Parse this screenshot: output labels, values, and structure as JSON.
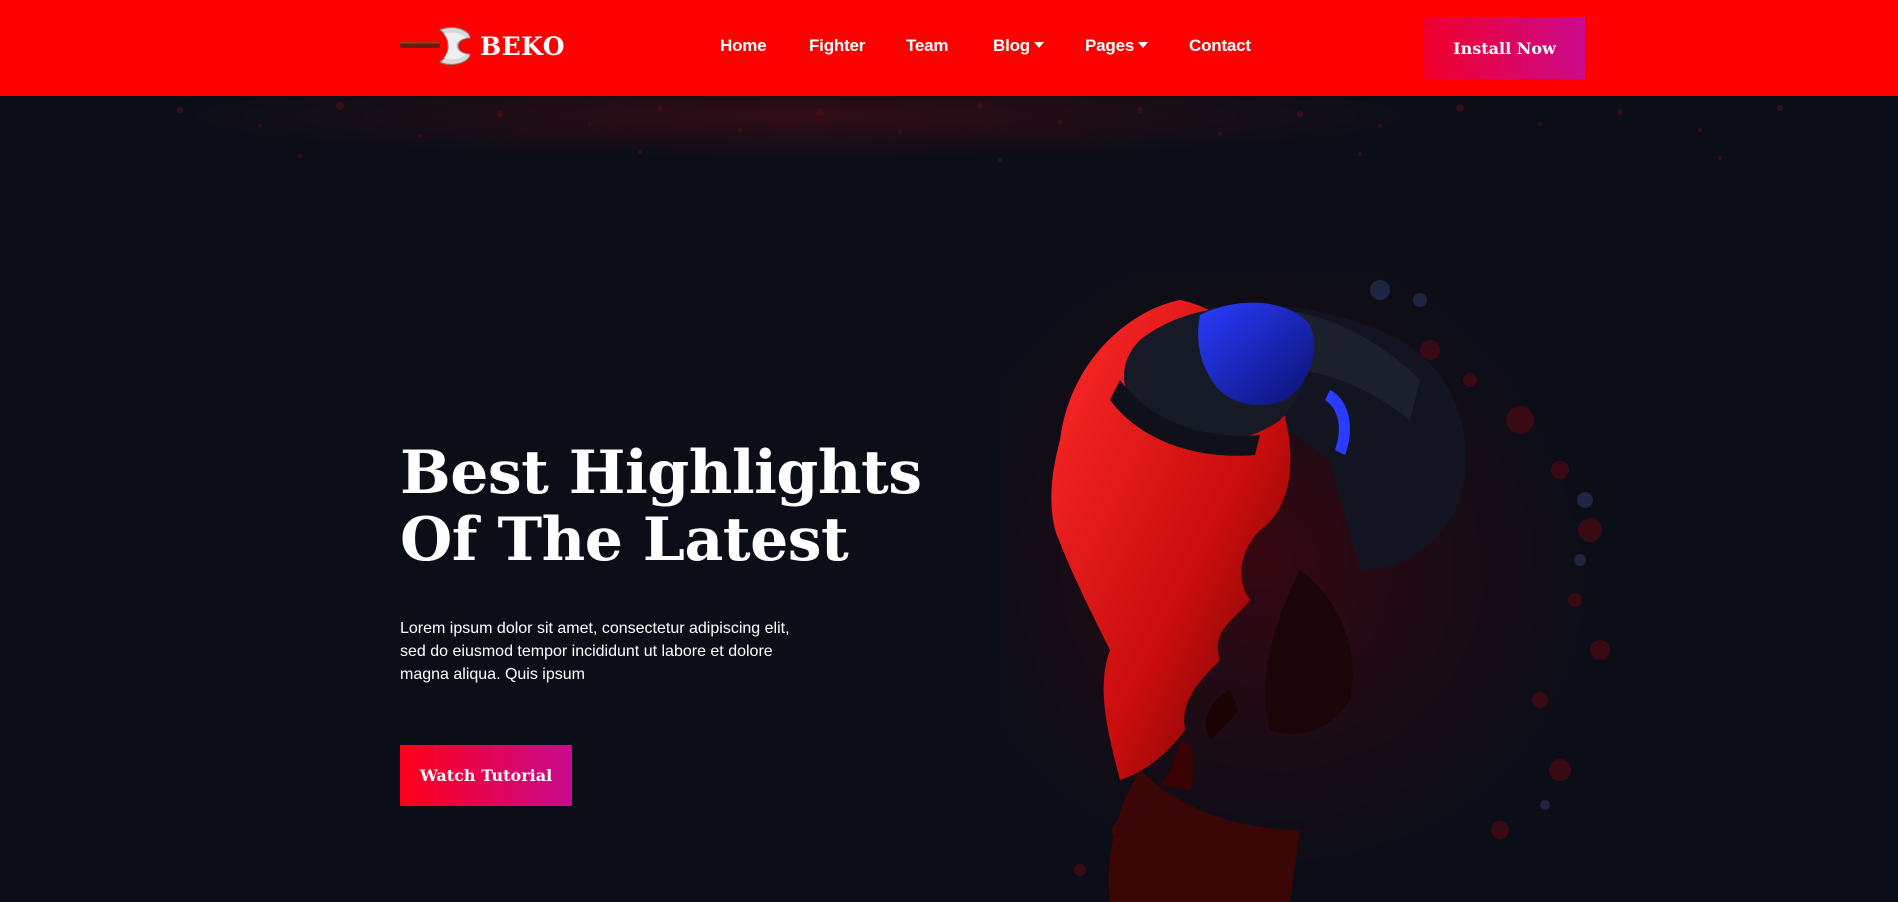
{
  "brand": {
    "name": "BEKO",
    "logo_icon": "axe-icon"
  },
  "nav": {
    "items": [
      {
        "label": "Home",
        "dropdown": false
      },
      {
        "label": "Fighter",
        "dropdown": false
      },
      {
        "label": "Team",
        "dropdown": false
      },
      {
        "label": "Blog",
        "dropdown": true
      },
      {
        "label": "Pages",
        "dropdown": true
      },
      {
        "label": "Contact",
        "dropdown": false
      }
    ],
    "install_label": "Install Now"
  },
  "hero": {
    "title_line1": "Best Highlights",
    "title_line2": "Of The Latest",
    "description_lines": [
      "Lorem ipsum dolor sit amet, consectetur adipiscing elit,",
      "sed do eiusmod tempor incididunt ut labore et dolore",
      "magna aliqua. Quis ipsum"
    ],
    "cta_label": "Watch Tutorial",
    "image_subject": "vr-headset-person-illustration"
  },
  "colors": {
    "header_bg": "#ff0000",
    "page_bg": "#0b0e17",
    "accent_gradient_start": "#ff0019",
    "accent_gradient_end": "#c70a8e",
    "text": "#ffffff"
  }
}
